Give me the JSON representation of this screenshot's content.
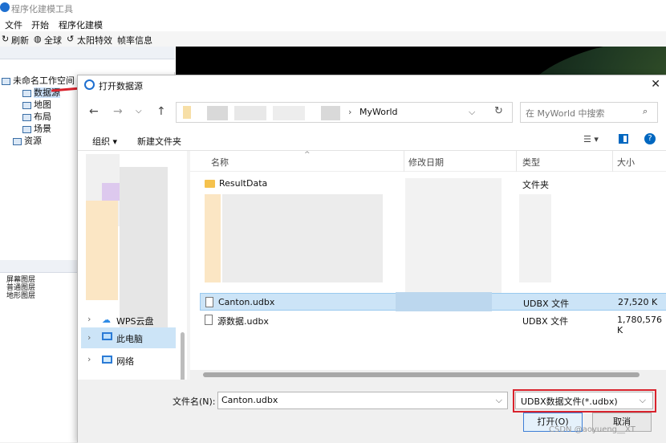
{
  "app": {
    "title": "程序化建模工具",
    "menu": [
      "文件",
      "开始",
      "程序化建模"
    ],
    "toolbar": [
      "刷新",
      "全球",
      "太阳特效",
      "帧率信息"
    ],
    "tree": {
      "workspace": "未命名工作空间",
      "items": [
        "数据源",
        "地图",
        "布局",
        "场景",
        "资源"
      ]
    },
    "layers": [
      "屏幕图层",
      "普通图层",
      "地形图层"
    ]
  },
  "dialog": {
    "title": "打开数据源",
    "address_current": "MyWorld",
    "search_placeholder": "在 MyWorld 中搜索",
    "organize_label": "组织",
    "new_folder_label": "新建文件夹",
    "nav_items": [
      "WPS云盘",
      "此电脑",
      "网络"
    ],
    "columns": [
      "名称",
      "修改日期",
      "类型",
      "大小"
    ],
    "files": [
      {
        "name": "ResultData",
        "type": "文件夹",
        "size": ""
      },
      {
        "name": "Canton.udbx",
        "type": "UDBX 文件",
        "size": "27,520 K"
      },
      {
        "name": "源数据.udbx",
        "type": "UDBX 文件",
        "size": "1,780,576 K"
      }
    ],
    "filename_label": "文件名(N):",
    "filename_value": "Canton.udbx",
    "filetype_value": "UDBX数据文件(*.udbx)",
    "open_label": "打开(O)",
    "cancel_label": "取消"
  },
  "watermark": "CSDN @aoyueng__XT",
  "colors": {
    "accent": "#0067c0",
    "highlight_red": "#d9232d",
    "selected_row": "#cce4f7"
  }
}
